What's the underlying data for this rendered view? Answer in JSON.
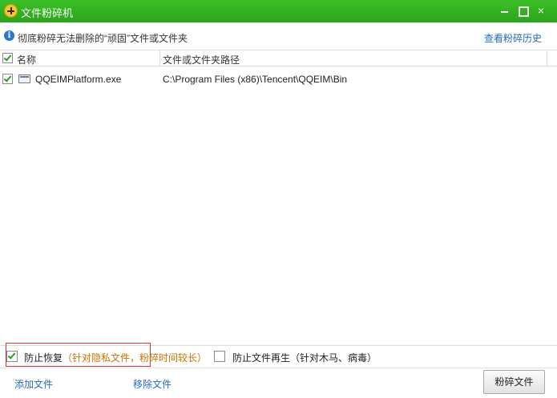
{
  "window": {
    "title": "文件粉碎机",
    "minimize_icon": "minimize-icon",
    "maximize_icon": "maximize-icon",
    "close_icon": "close-icon",
    "close_glyph": "×"
  },
  "info": {
    "icon_glyph": "i",
    "text": "彻底粉碎无法删除的“顽固”文件或文件夹",
    "history_link": "查看粉碎历史"
  },
  "list": {
    "columns": [
      "名称",
      "文件或文件夹路径"
    ],
    "rows": [
      {
        "checked": true,
        "name": "QQEIMPlatform.exe",
        "path": "C:\\Program Files (x86)\\Tencent\\QQEIM\\Bin"
      }
    ]
  },
  "options": {
    "prevent_recovery": {
      "checked": true,
      "label": "防止恢复",
      "note": "（针对隐私文件，粉碎时间较长）"
    },
    "prevent_regen": {
      "checked": false,
      "label": "防止文件再生（针对木马、病毒）"
    }
  },
  "actions": {
    "add_file": "添加文件",
    "remove_file": "移除文件",
    "shred": "粉碎文件"
  },
  "colors": {
    "titlebar": "#2aa51b",
    "link": "#2569c0",
    "note": "#d07000",
    "highlight": "#dd3333"
  }
}
